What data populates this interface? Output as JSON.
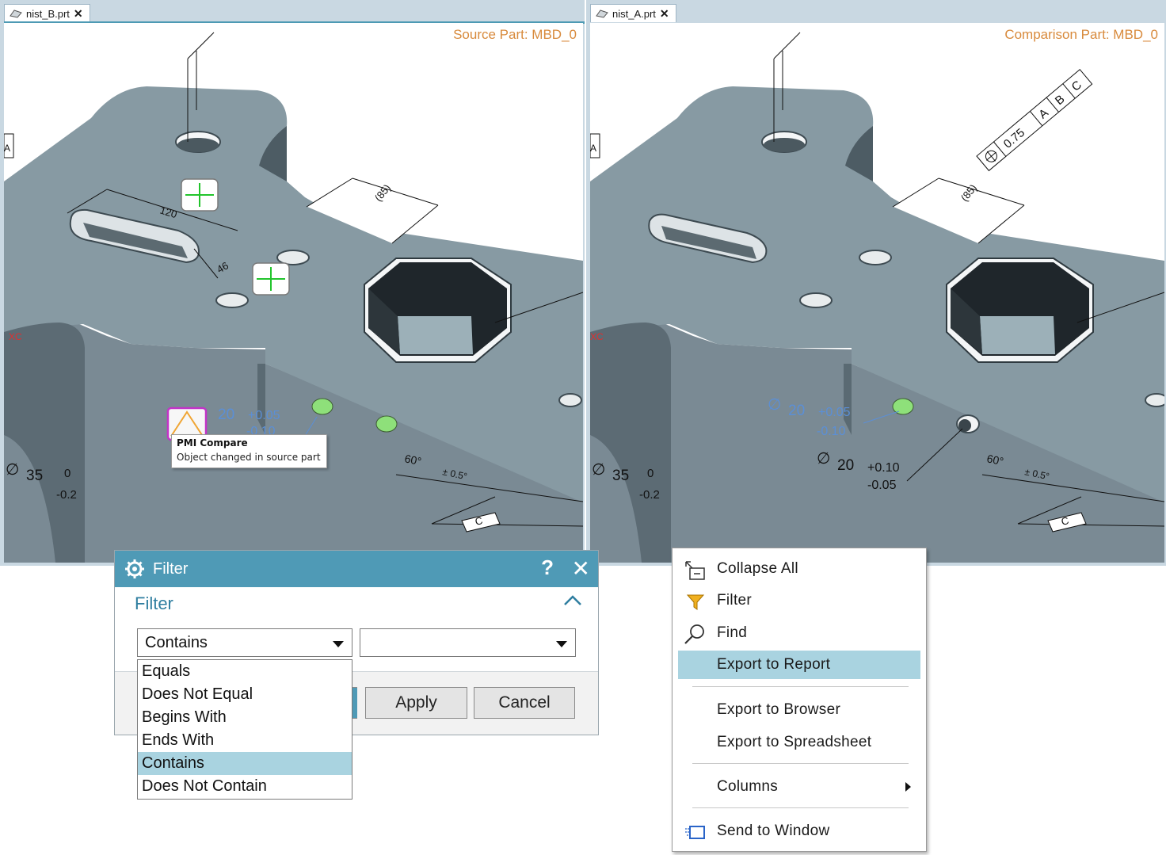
{
  "left_view": {
    "tab": {
      "label": "nist_B.prt",
      "close": "✕"
    },
    "part_label": "Source Part: MBD_0",
    "dims": {
      "d120": "120",
      "d46": "46",
      "d85": "(85)",
      "phi20": "20",
      "tol_plus005": "+0.05",
      "tol_minus010": "-0.10",
      "phi35": "35",
      "tol_zero": "0",
      "tol_minus02": "-0.2",
      "angle60": "60°",
      "tol_05": "± 0.5°",
      "datum_c": "C",
      "datum_a": "A",
      "xc": "XC"
    },
    "tooltip": {
      "title": "PMI Compare",
      "body": "Object changed in source part"
    }
  },
  "right_view": {
    "tab": {
      "label": "nist_A.prt",
      "close": "✕"
    },
    "part_label": "Comparison Part: MBD_0",
    "dims": {
      "d85": "(85)",
      "fcf_tol": "0.75",
      "fcf_a": "A",
      "fcf_b": "B",
      "fcf_c": "C",
      "phi20a": "20",
      "tol_plus005": "+0.05",
      "tol_minus010": "-0.10",
      "phi20b": "20",
      "tol_plus010": "+0.10",
      "tol_minus005": "-0.05",
      "phi35": "35",
      "tol_zero": "0",
      "tol_minus02": "-0.2",
      "angle60": "60°",
      "tol_05": "± 0.5°",
      "datum_c": "C",
      "datum_a": "A",
      "xc": "XC"
    }
  },
  "filter_dialog": {
    "title": "Filter",
    "help": "?",
    "close": "✕",
    "section_title": "Filter",
    "operator_value": "Contains",
    "value_field": "",
    "apply_label": "Apply",
    "cancel_label": "Cancel",
    "options": [
      "Equals",
      "Does Not Equal",
      "Begins With",
      "Ends With",
      "Contains",
      "Does Not Contain"
    ],
    "selected_option": "Contains"
  },
  "context_menu": {
    "items": {
      "collapse_all": "Collapse All",
      "filter": "Filter",
      "find": "Find",
      "export_report": "Export to Report",
      "export_browser": "Export to Browser",
      "export_spreadsheet": "Export to Spreadsheet",
      "columns": "Columns",
      "send_window": "Send to Window"
    },
    "highlighted": "Export to Report"
  },
  "colors": {
    "accent": "#4f9ab6",
    "part_label": "#d88a3c",
    "highlight": "#a9d3e0",
    "pmi_changed": "#c233c8",
    "dim_blue": "#5b8fd6"
  }
}
